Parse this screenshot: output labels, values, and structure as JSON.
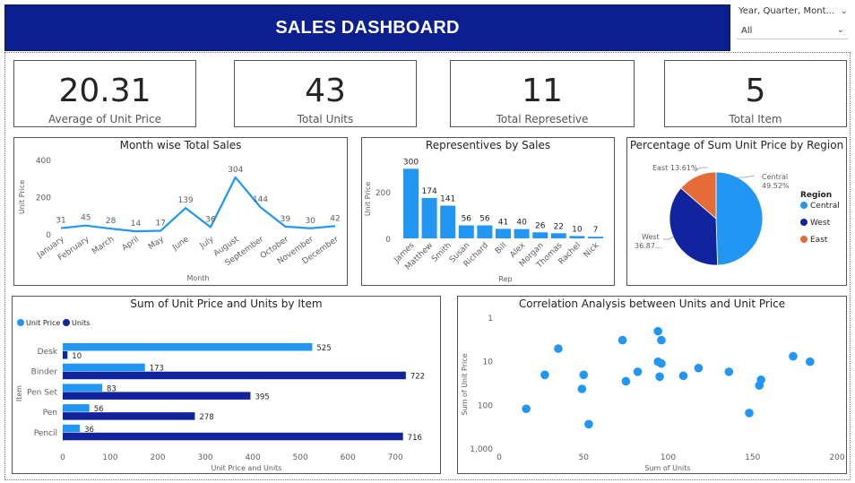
{
  "header": {
    "title": "SALES DASHBOARD"
  },
  "slicer": {
    "title": "Year, Quarter, Mont...",
    "value": "All"
  },
  "colors": {
    "light_blue": "#2196F3",
    "dark_blue": "#12239E",
    "orange": "#E66C37",
    "title_bg": "#0b1f8f"
  },
  "cards": [
    {
      "value": "20.31",
      "label": "Average of Unit Price"
    },
    {
      "value": "43",
      "label": "Total Units"
    },
    {
      "value": "11",
      "label": "Total Represetive"
    },
    {
      "value": "5",
      "label": "Total Item"
    }
  ],
  "chart_data": [
    {
      "type": "line",
      "title": "Month wise Total Sales",
      "xlabel": "Month",
      "ylabel": "Unit Price",
      "categories": [
        "January",
        "February",
        "March",
        "April",
        "May",
        "June",
        "July",
        "August",
        "September",
        "October",
        "November",
        "December"
      ],
      "values": [
        31,
        45,
        28,
        14,
        17,
        139,
        36,
        304,
        144,
        39,
        30,
        42
      ],
      "data_labels": [
        "31",
        "45",
        "28",
        "14",
        "17",
        "139",
        "36",
        "304",
        "144",
        "39",
        "30",
        "42"
      ],
      "ylim": [
        0,
        400
      ],
      "yticks": [
        "0",
        "200",
        "400"
      ]
    },
    {
      "type": "bar",
      "title": "Representives by Sales",
      "xlabel": "Rep",
      "ylabel": "Unit Price",
      "categories": [
        "James",
        "Matthew",
        "Smith",
        "Susan",
        "Richard",
        "Bill",
        "Alex",
        "Morgan",
        "Thomas",
        "Rachel",
        "Nick"
      ],
      "values": [
        300,
        174,
        141,
        56,
        56,
        41,
        40,
        26,
        22,
        10,
        7
      ],
      "data_labels": [
        "300",
        "174",
        "141",
        "56",
        "56",
        "41",
        "40",
        "26",
        "22",
        "10",
        "7"
      ],
      "ylim": [
        0,
        340
      ],
      "yticks": [
        "0",
        "200"
      ]
    },
    {
      "type": "pie",
      "title": "Percentage of Sum Unit Price by Region",
      "legend_title": "Region",
      "legend": [
        "Central",
        "West",
        "East"
      ],
      "values": [
        49.52,
        36.87,
        13.61
      ],
      "labels": [
        {
          "name": "Central",
          "pct": "49.52%"
        },
        {
          "name": "West",
          "pct": "36.87..."
        },
        {
          "name": "East",
          "pct": "13.61%"
        }
      ]
    },
    {
      "type": "bar",
      "title": "Sum of Unit Price and Units by Item",
      "xlabel": "Unit Price and Units",
      "ylabel": "Item",
      "categories": [
        "Desk",
        "Binder",
        "Pen Set",
        "Pen",
        "Pencil"
      ],
      "series": [
        {
          "name": "Unit Price",
          "values": [
            525,
            173,
            83,
            56,
            36
          ],
          "labels": [
            "525",
            "173",
            "83",
            "56",
            "36"
          ]
        },
        {
          "name": "Units",
          "values": [
            10,
            722,
            395,
            278,
            716
          ],
          "labels": [
            "10",
            "722",
            "395",
            "278",
            "716"
          ]
        }
      ],
      "xlim": [
        0,
        760
      ],
      "xticks": [
        "0",
        "100",
        "200",
        "300",
        "400",
        "500",
        "600",
        "700"
      ]
    },
    {
      "type": "scatter",
      "title": "Correlation Analysis between Units and Unit Price",
      "xlabel": "Sum of Units",
      "ylabel": "Sum of Unit Price",
      "x_scale": "linear",
      "y_scale": "log",
      "y_reversed": true,
      "xlim": [
        0,
        200
      ],
      "ylim": [
        1,
        1000
      ],
      "xticks": [
        "0",
        "50",
        "100",
        "150",
        "200"
      ],
      "yticks": [
        "1",
        "10",
        "100",
        "1,000"
      ],
      "points": [
        {
          "x": 16,
          "y": 120
        },
        {
          "x": 27,
          "y": 20
        },
        {
          "x": 35,
          "y": 5
        },
        {
          "x": 49,
          "y": 42
        },
        {
          "x": 50,
          "y": 20
        },
        {
          "x": 53,
          "y": 270
        },
        {
          "x": 73,
          "y": 3.2
        },
        {
          "x": 75,
          "y": 28
        },
        {
          "x": 82,
          "y": 17
        },
        {
          "x": 94,
          "y": 2
        },
        {
          "x": 94,
          "y": 10
        },
        {
          "x": 95,
          "y": 22
        },
        {
          "x": 96,
          "y": 3.2
        },
        {
          "x": 96,
          "y": 11
        },
        {
          "x": 109,
          "y": 21
        },
        {
          "x": 118,
          "y": 14
        },
        {
          "x": 136,
          "y": 17
        },
        {
          "x": 148,
          "y": 150
        },
        {
          "x": 154,
          "y": 35
        },
        {
          "x": 155,
          "y": 26
        },
        {
          "x": 174,
          "y": 7.5
        },
        {
          "x": 184,
          "y": 10
        }
      ]
    }
  ]
}
